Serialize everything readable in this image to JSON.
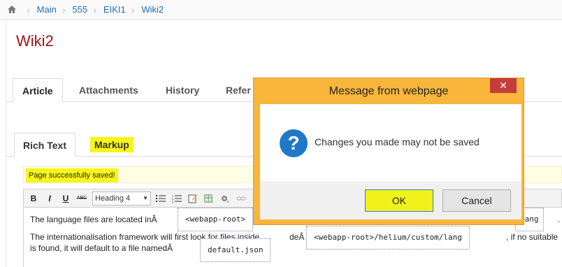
{
  "breadcrumb": {
    "items": [
      "Main",
      "555",
      "EIKI1",
      "Wiki2"
    ]
  },
  "page": {
    "title": "Wiki2"
  },
  "main_tabs": [
    "Article",
    "Attachments",
    "History",
    "Refer"
  ],
  "sub_tabs": [
    "Rich Text",
    "Markup"
  ],
  "status": {
    "message": "Page successfully saved!"
  },
  "toolbar": {
    "bold": "B",
    "italic": "I",
    "underline": "U",
    "strike": "ABC",
    "heading_select": "Heading 4"
  },
  "editor": {
    "line1": "The language files are located inÂ",
    "line1_end": ".",
    "code1": "<webapp-root>",
    "code1_tail": "lang",
    "line2": "The internationalisation framework will first look for files inside",
    "line2_a": "deÂ",
    "code2": "<webapp-root>/helium/custom/lang",
    "line2_b": ", if no suitable",
    "line3": "is found, it will default to a file namedÂ",
    "code3": "default.json"
  },
  "dialog": {
    "title": "Message from webpage",
    "close": "✕",
    "message": "Changes you made may not be saved",
    "ok": "OK",
    "cancel": "Cancel"
  },
  "colors": {
    "title": "#a01318",
    "link": "#1f6fb2",
    "highlight": "#f6f61a",
    "dialog_frame": "#f8b63a"
  }
}
